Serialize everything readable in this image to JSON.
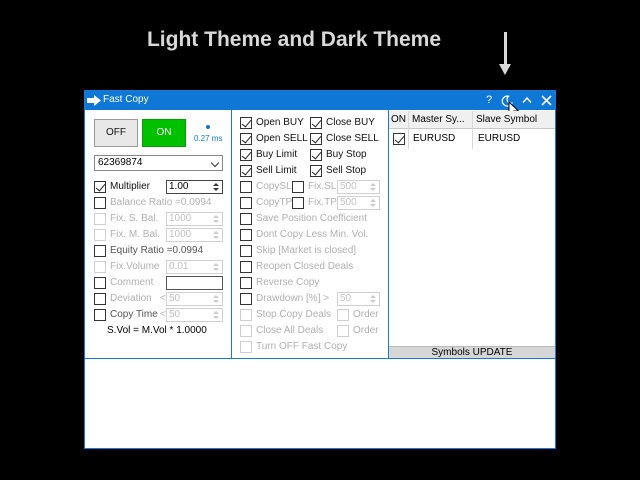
{
  "caption": "Light Theme and Dark Theme",
  "window": {
    "title": "Fast Copy",
    "help_label": "?",
    "icons": [
      "arrow-right-icon",
      "moon-icon",
      "chevron-up-icon",
      "close-icon"
    ]
  },
  "colors": {
    "accent": "#0f78d7",
    "on_green": "#00c000",
    "background": "#000000"
  },
  "left_panel": {
    "off_label": "OFF",
    "on_label": "ON",
    "latency": "0.27 ms",
    "account": "62369874",
    "multiplier": {
      "label": "Multiplier",
      "value": "1.00",
      "checked": true
    },
    "balance_ratio": {
      "label": "Balance Ratio =0.0994"
    },
    "fix_s_bal": {
      "label": "Fix. S. Bal.",
      "value": "1000"
    },
    "fix_m_bal": {
      "label": "Fix. M. Bal.",
      "value": "1000"
    },
    "equity_ratio": {
      "label": "Equity Ratio =0.0994"
    },
    "fix_volume": {
      "label": "Fix.Volume",
      "value": "0.01"
    },
    "comment": {
      "label": "Comment",
      "value": ""
    },
    "deviation": {
      "label": "Deviation",
      "op": "<",
      "value": "50"
    },
    "copy_time": {
      "label": "Copy Time",
      "op": "<",
      "value": "50"
    },
    "formula": "S.Vol  =  M.Vol * 1.0000"
  },
  "middle_panel": {
    "open_buy": "Open BUY",
    "close_buy": "Close BUY",
    "open_sell": "Open SELL",
    "close_sell": "Close SELL",
    "buy_limit": "Buy Limit",
    "buy_stop": "Buy Stop",
    "sell_limit": "Sell Limit",
    "sell_stop": "Sell Stop",
    "copy_sl": "CopySL",
    "fix_sl": "Fix.SL",
    "fix_sl_value": "500",
    "copy_tp": "CopyTP",
    "fix_tp": "Fix.TP",
    "fix_tp_value": "500",
    "save_position_coefficient": "Save Position Coefficient",
    "dont_copy_less": "Dont Copy Less Min. Vol.",
    "skip_market_closed": "Skip [Market is closed]",
    "reopen_closed": "Reopen Closed Deals",
    "reverse_copy": "Reverse Copy",
    "drawdown": "Drawdown [%] >",
    "drawdown_value": "50",
    "stop_copy_deals": "Stop Copy Deals",
    "close_all_deals": "Close All Deals",
    "order_label_1": "Order",
    "order_label_2": "Order",
    "turn_off": "Turn OFF Fast Copy"
  },
  "right_panel": {
    "headers": [
      "ON",
      "Master Sy...",
      "Slave Symbol"
    ],
    "rows": [
      {
        "on": true,
        "master": "EURUSD",
        "slave": "EURUSD"
      }
    ],
    "update_button": "Symbols UPDATE"
  }
}
